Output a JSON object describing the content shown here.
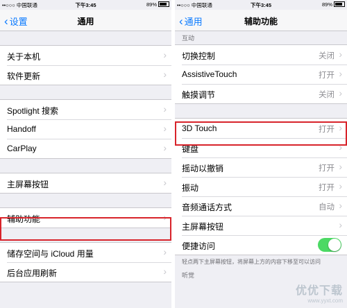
{
  "status_bar": {
    "carrier": "••○○○ 中国联通",
    "time": "下午3:45",
    "battery": "89%"
  },
  "left": {
    "nav": {
      "back": "设置",
      "title": "通用"
    },
    "groups": [
      [
        "关于本机",
        "软件更新"
      ],
      [
        "Spotlight 搜索",
        "Handoff",
        "CarPlay"
      ],
      [
        "主屏幕按钮"
      ],
      [
        "辅助功能"
      ],
      [
        "储存空间与 iCloud 用量",
        "后台应用刷新"
      ]
    ]
  },
  "right": {
    "nav": {
      "back": "通用",
      "title": "辅助功能"
    },
    "section_interaction": "互动",
    "group1": [
      {
        "label": "切换控制",
        "value": "关闭"
      },
      {
        "label": "AssistiveTouch",
        "value": "打开"
      },
      {
        "label": "触摸调节",
        "value": "关闭"
      }
    ],
    "group2": [
      {
        "label": "3D Touch",
        "value": "打开"
      },
      {
        "label": "键盘",
        "value": ""
      },
      {
        "label": "摇动以撤销",
        "value": "打开"
      },
      {
        "label": "振动",
        "value": "打开"
      },
      {
        "label": "音频通话方式",
        "value": "自动"
      },
      {
        "label": "主屏幕按钮",
        "value": ""
      },
      {
        "label": "便捷访问",
        "toggle": true
      }
    ],
    "footer": "轻点两下主屏幕按钮，将屏幕上方的内容下移至可以访问",
    "section_hearing": "听觉"
  },
  "watermark": {
    "text": "优优下载",
    "url": "www.yyxt.com"
  },
  "colors": {
    "accent": "#0a7aff",
    "highlight": "#d8232a",
    "toggle_on": "#4cd964"
  }
}
